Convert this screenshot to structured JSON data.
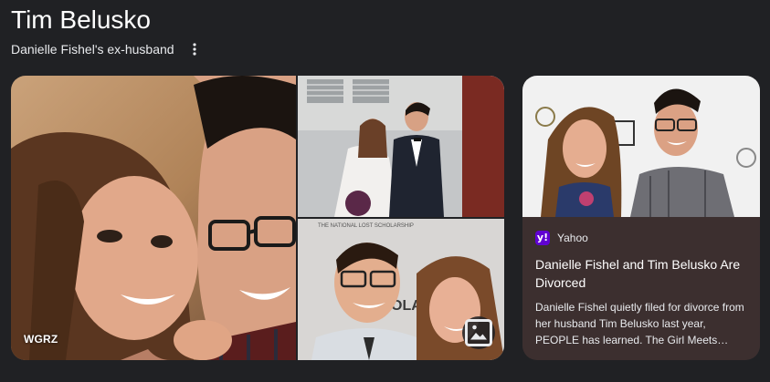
{
  "entity": {
    "title": "Tim Belusko",
    "subtitle": "Danielle Fishel's ex-husband"
  },
  "icons": {
    "more_options": "more-vert-icon",
    "image_view": "image-icon",
    "publisher_logo": "yahoo-logo"
  },
  "images": {
    "main": {
      "source": "WGRZ"
    },
    "top_right": {},
    "bottom_right": {
      "watermark_text": "THE NATIONAL LOST SCHOLARSHIP"
    }
  },
  "article": {
    "publisher": "Yahoo",
    "publisher_logo_letter": "y!",
    "headline": "Danielle Fishel and Tim Belusko Are Divorced",
    "snippet": "Danielle Fishel quietly filed for divorce from her husband Tim Belusko last year, PEOPLE has learned. The Girl Meets…"
  },
  "colors": {
    "background": "#202124",
    "card_background": "#3c2f2f",
    "yahoo_purple": "#6001d2",
    "text_primary": "#ffffff"
  }
}
